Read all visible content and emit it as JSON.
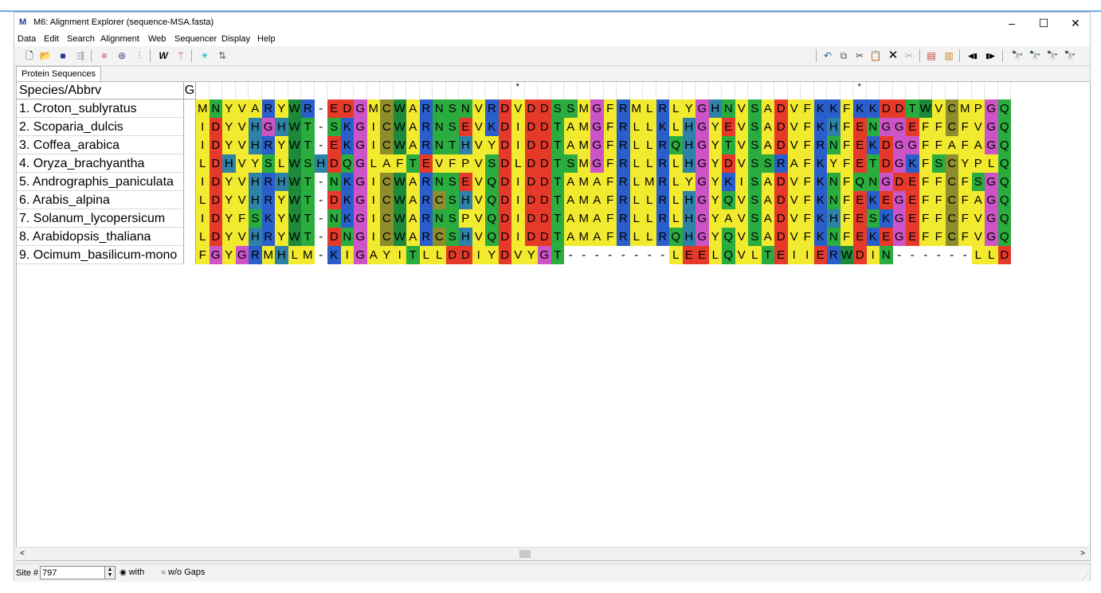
{
  "window": {
    "title": "M6: Alignment Explorer (sequence-MSA.fasta)",
    "icon": "M",
    "minimize": "–",
    "maximize": "☐",
    "close": "✕"
  },
  "menu": [
    "Data",
    "Edit",
    "Search",
    "Alignment",
    "Web",
    "Sequencer",
    "Display",
    "Help"
  ],
  "tab": "Protein Sequences",
  "grid": {
    "header": "Species/Abbrv",
    "g_header": "G",
    "consensus": "                        *                         *                                                                        ",
    "species": [
      "1. Croton_sublyratus",
      "2. Scoparia_dulcis",
      "3. Coffea_arabica",
      "4. Oryza_brachyantha",
      "5. Andrographis_paniculata",
      "6. Arabis_alpina",
      "7. Solanum_lycopersicum",
      "8. Arabidopsis_thaliana",
      "9. Ocimum_basilicum-mono"
    ],
    "sequences": [
      "MNYVARYWR-EDGMCWARNSNVRDVDDSSMGFRMLRLYGHNVSADVFKKFKKDDTWVCMPGQ",
      "IDYVHGHWT-SKGICWARNSEVKDIDDTAMGFRLLKLHGYEVSADVFKHFENGGEFFCFVGQ",
      "IDYVHRYWT-EKGICWARNTHVYDIDDTAMGFRLLRQHGYTVSADVFRNFEKDGGFFAFAGQ",
      "LDHVYSLWSHDQGLAFTEVFPVSDLDDTSMGFRLLRLHGYDVSSRAFKYFETDGKFSCYPLQ",
      "IDYVHRHWT-NKGICWARNSEVQDIDDTAMAFRLMRLYGYKISADVFKNFQNGDEFFCFSGQ",
      "LDYVHRYWT-DKGICWARCSHVQDIDDTAMAFRLLRLHGYQVSADVFKNFEKEGEFFCFAGQ",
      "IDYFSKYWT-NKGICWARNSPVQDIDDTAMAFRLLRLHGYAVSADVFKHFESKGEFFCFVGQ",
      "LDYVHRYWT-DNGICWARCSHVQDIDDTAMAFRLLRQHGYQVSADVFKNFEKEGEFFCFVGQ",
      "FGYGRMHLM-KIGAYITLLDDIYDVYGT--------LEELQVLTEIIERWDIN------LLD"
    ],
    "residue_colors": {
      "A": "#f2ea2e",
      "V": "#f2ea2e",
      "L": "#f2ea2e",
      "I": "#f2ea2e",
      "M": "#f2ea2e",
      "F": "#f2ea2e",
      "P": "#f2ea2e",
      "Y": "#f2ea2e",
      "W": "#1c8a3a",
      "C": "#8d8d2c",
      "G": "#cc54c6",
      "H": "#2e82a8",
      "S": "#2aac3f",
      "T": "#2aac3f",
      "N": "#2aac3f",
      "Q": "#2aac3f",
      "K": "#2a5fcb",
      "R": "#2a5fcb",
      "D": "#e53a2a",
      "E": "#e53a2a",
      "-": "#ffffff"
    }
  },
  "status": {
    "site_label": "Site #",
    "site_value": "797",
    "with_label": "with",
    "without_label": "w/o Gaps"
  },
  "scroll": {
    "left": "<",
    "right": ">"
  }
}
